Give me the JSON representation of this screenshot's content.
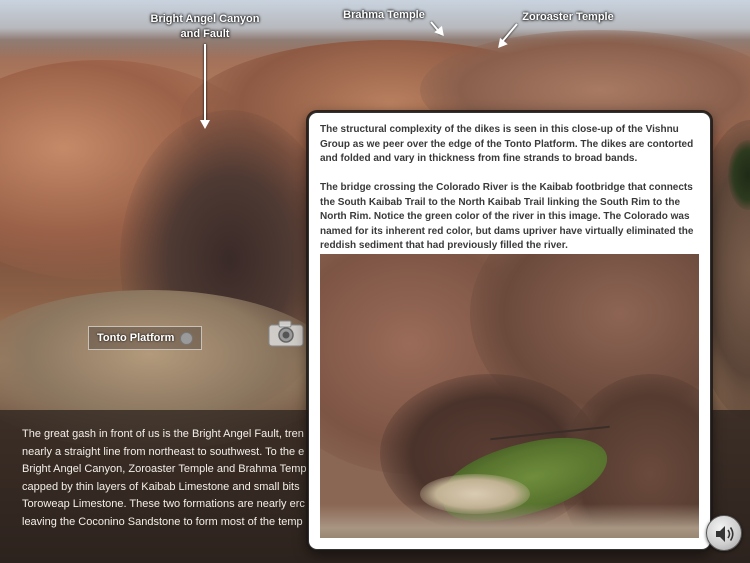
{
  "labels": {
    "bright_angel": "Bright Angel Canyon and Fault",
    "brahma": "Brahma Temple",
    "zoroaster": "Zoroaster Temple"
  },
  "tonto_button": {
    "label": "Tonto Platform"
  },
  "narration": {
    "lines": [
      "The great gash in front of us is the Bright Angel Fault, tren",
      "nearly a straight line from northeast to southwest. To the e",
      "Bright Angel Canyon, Zoroaster Temple and Brahma Temp",
      "capped by thin layers of Kaibab Limestone and small bits",
      "Toroweap Limestone. These two formations are nearly erc",
      "leaving the Coconino Sandstone to form most of the temp"
    ]
  },
  "popup": {
    "paragraph1": "The structural complexity of the dikes is seen in this close-up of the Vishnu Group as we peer over the edge of the Tonto Platform. The dikes are contorted and folded and vary in thickness from fine strands to broad bands.",
    "paragraph2": "The bridge crossing the Colorado River is the Kaibab footbridge that connects the South Kaibab Trail to the North Kaibab Trail linking the South Rim to the North Rim. Notice the green color of the river in this image. The Colorado was named for its inherent red color, but dams upriver have virtually eliminated the reddish sediment that had previously filled the river."
  },
  "icons": {
    "camera": "camera-icon",
    "speaker": "speaker-icon"
  }
}
